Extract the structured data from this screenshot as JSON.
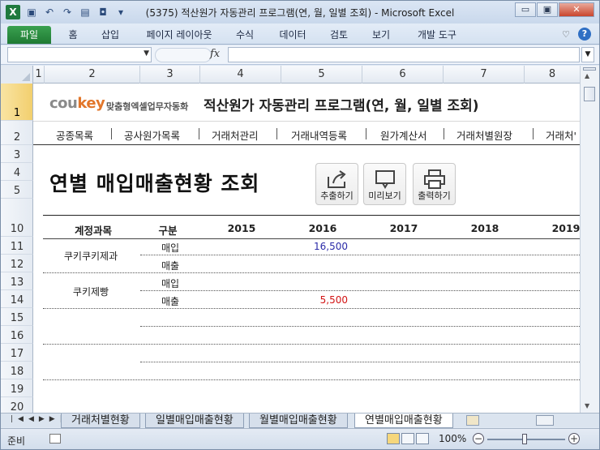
{
  "window": {
    "title": "(5375) 적산원가 자동관리 프로그램(연, 월, 일별 조회)  -  Microsoft Excel",
    "controls": {
      "minimize": "▭",
      "restore": "▣",
      "close": "✕"
    }
  },
  "ribbon": {
    "tabs": [
      "파일",
      "홈",
      "삽입",
      "페이지 레이아웃",
      "수식",
      "데이터",
      "검토",
      "보기",
      "개발 도구"
    ]
  },
  "formula_bar": {
    "name_box": "",
    "fx": "fx",
    "value": ""
  },
  "columns": [
    "1",
    "2",
    "3",
    "4",
    "5",
    "6",
    "7",
    "8"
  ],
  "rows": [
    "1",
    "2",
    "3",
    "4",
    "5",
    "10",
    "11",
    "12",
    "13",
    "14",
    "15",
    "16",
    "17",
    "18",
    "19",
    "20"
  ],
  "sheet": {
    "logo": {
      "brand_cou": "cou",
      "brand_key": "key",
      "tagline": "맞춤형엑셀업무자동화"
    },
    "app_title": "적산원가 자동관리 프로그램(연, 월, 일별 조회)",
    "nav": [
      "공종목록",
      "공사원가목록",
      "거래처관리",
      "거래내역등록",
      "원가계산서",
      "거래처별원장",
      "거래처'"
    ],
    "page_title": "연별 매입매출현황 조회",
    "buttons": {
      "export": "추출하기",
      "preview": "미리보기",
      "print": "출력하기"
    },
    "table": {
      "headers": [
        "계정과목",
        "구분",
        "2015",
        "2016",
        "2017",
        "2018",
        "2019"
      ],
      "rows": [
        {
          "account": "쿠키쿠키제과",
          "lines": [
            {
              "type": "매입",
              "v2016": "16,500"
            },
            {
              "type": "매출",
              "v2016": ""
            }
          ]
        },
        {
          "account": "쿠키제빵",
          "lines": [
            {
              "type": "매입",
              "v2016": ""
            },
            {
              "type": "매출",
              "v2016": "5,500"
            }
          ]
        }
      ]
    }
  },
  "sheet_tabs": [
    "거래처별현황",
    "일별매입매출현황",
    "월별매입매출현황",
    "연별매입매출현황"
  ],
  "active_sheet": "연별매입매출현황",
  "status": {
    "ready": "준비",
    "zoom": "100%",
    "zoom_minus": "−",
    "zoom_plus": "+"
  },
  "colors": {
    "file_tab": "#1f7a33",
    "blue_value": "#2b2ba8",
    "red_value": "#d21414",
    "logo_key": "#e2762a"
  }
}
